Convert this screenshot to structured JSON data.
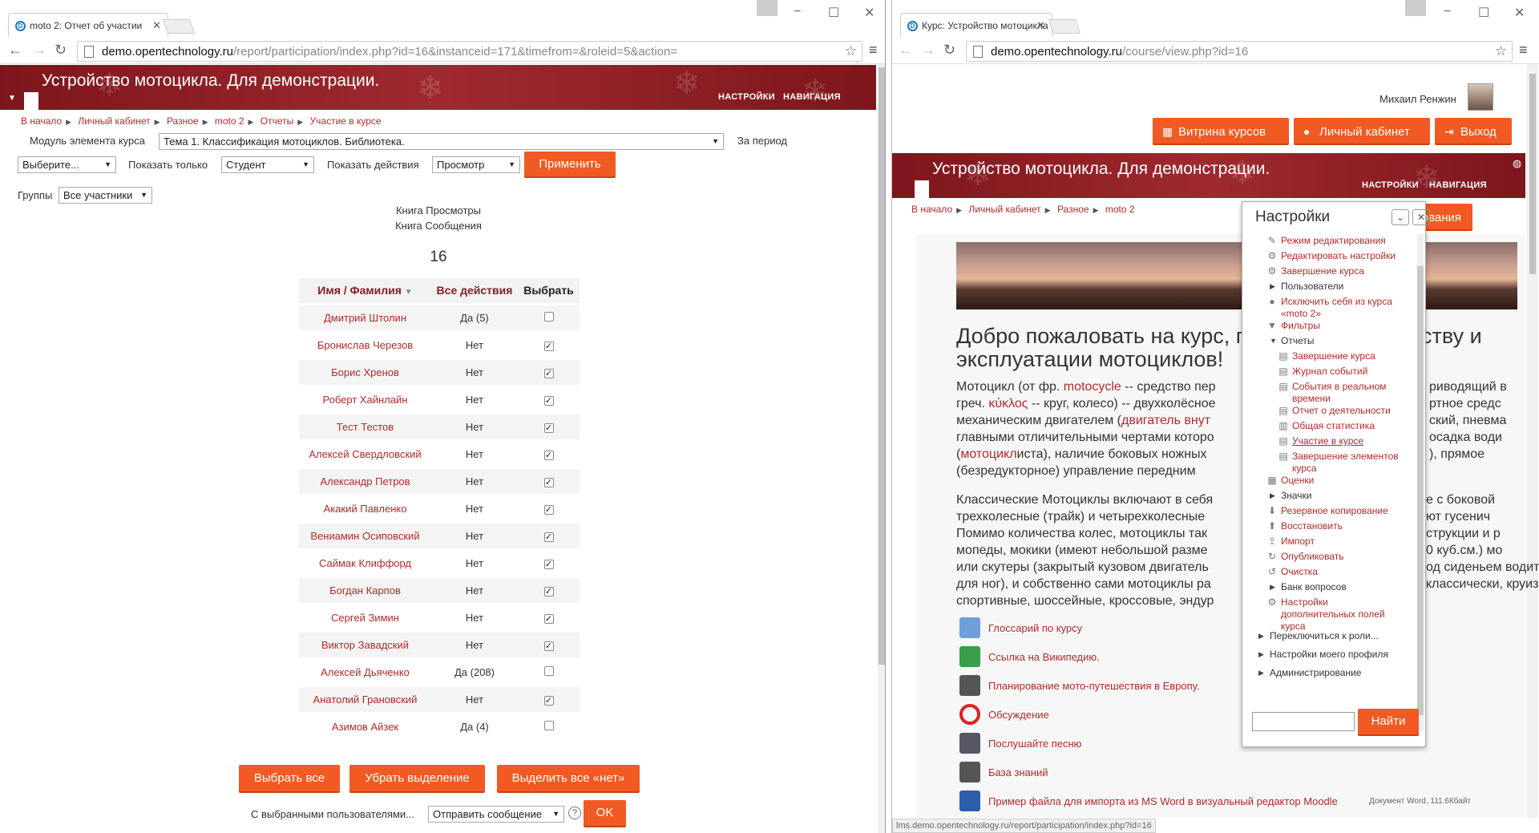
{
  "left": {
    "tab_title": "moto 2: Отчет об участии",
    "url_domain": "demo.opentechnology.ru",
    "url_path": "/report/participation/index.php?id=16&instanceid=171&timefrom=&roleid=5&action=",
    "course_title": "Устройство мотоцикла. Для демонстрации.",
    "nav_settings": "НАСТРОЙКИ",
    "nav_navigation": "НАВИГАЦИЯ",
    "breadcrumb": [
      "В начало",
      "Личный кабинет",
      "Разное",
      "moto 2",
      "Отчеты",
      "Участие в курсе"
    ],
    "form": {
      "module_label": "Модуль элемента курса",
      "module_value": "Тема 1. Классификация мотоциклов. Библиотека.",
      "period_label": "За период",
      "period_value": "Выберите...",
      "show_only_label": "Показать только",
      "show_only_value": "Студент",
      "show_actions_label": "Показать действия",
      "show_actions_value": "Просмотр",
      "apply": "Применить",
      "groups_label": "Группы",
      "groups_value": "Все участники"
    },
    "report": {
      "line1": "Книга Просмотры",
      "line2": "Книга Сообщения",
      "count": "16"
    },
    "table": {
      "headers": {
        "name": "Имя / Фамилия",
        "actions": "Все действия",
        "select": "Выбрать"
      },
      "rows": [
        {
          "name": "Дмитрий Штолин",
          "actions": "Да (5)",
          "checked": false
        },
        {
          "name": "Бронислав Черезов",
          "actions": "Нет",
          "checked": true
        },
        {
          "name": "Борис Хренов",
          "actions": "Нет",
          "checked": true
        },
        {
          "name": "Роберт Хайнлайн",
          "actions": "Нет",
          "checked": true
        },
        {
          "name": "Тест Тестов",
          "actions": "Нет",
          "checked": true
        },
        {
          "name": "Алексей Свердловский",
          "actions": "Нет",
          "checked": true
        },
        {
          "name": "Александр Петров",
          "actions": "Нет",
          "checked": true
        },
        {
          "name": "Акакий Павленко",
          "actions": "Нет",
          "checked": true
        },
        {
          "name": "Вениамин Осиповский",
          "actions": "Нет",
          "checked": true
        },
        {
          "name": "Саймак Клиффорд",
          "actions": "Нет",
          "checked": true
        },
        {
          "name": "Богдан Карпов",
          "actions": "Нет",
          "checked": true
        },
        {
          "name": "Сергей Зимин",
          "actions": "Нет",
          "checked": true
        },
        {
          "name": "Виктор Завадский",
          "actions": "Нет",
          "checked": true
        },
        {
          "name": "Алексей Дьяченко",
          "actions": "Да (208)",
          "checked": false
        },
        {
          "name": "Анатолий Грановский",
          "actions": "Нет",
          "checked": true
        },
        {
          "name": "Азимов Айзек",
          "actions": "Да (4)",
          "checked": false
        }
      ]
    },
    "buttons": {
      "select_all": "Выбрать все",
      "deselect": "Убрать выделение",
      "select_no": "Выделить все «нет»"
    },
    "bulk": {
      "label": "С выбранными пользователями...",
      "value": "Отправить сообщение",
      "ok": "OK"
    }
  },
  "right": {
    "tab_title": "Курс: Устройство мотоцикла",
    "url_domain": "demo.opentechnology.ru",
    "url_path": "/course/view.php?id=16",
    "user_name": "Михаил Ренжин",
    "btn_courses": "Витрина курсов",
    "btn_cabinet": "Личный кабинет",
    "btn_logout": "Выход",
    "course_title": "Устройство мотоцикла. Для демонстрации.",
    "nav_settings": "НАСТРОЙКИ",
    "nav_navigation": "НАВИГАЦИЯ",
    "breadcrumb": [
      "В начало",
      "Личный кабинет",
      "Разное",
      "moto 2"
    ],
    "edit_partial": "ирования",
    "heading_l1": "Добро пожаловать на курс, по",
    "heading_l1b": "ству и",
    "heading_l2": "эксплуатации мотоциклов!",
    "p1": [
      {
        "a": "Мотоцикл (от фр. ",
        "link": "motocycle",
        "b": " -- средство пер"
      },
      {
        "a": "греч. ",
        "link": "κύκλος",
        "b": " -- круг, колесо) -- двухколёсное"
      },
      {
        "a": "механическим двигателем (",
        "link": "двигатель внут",
        "b": ""
      },
      {
        "a": "главными отличительными чертами которо",
        "link": "",
        "b": ""
      },
      {
        "a": "(",
        "link": "мотоцикл",
        "b": "иста), наличие боковых ножных"
      },
      {
        "a": "(безредукторное) управление передним",
        "link": "",
        "b": ""
      }
    ],
    "p1_right": [
      "риводящий в",
      "ртное средс",
      "ский, пневма",
      "осадка води",
      "), прямое",
      ""
    ],
    "p2": [
      "Классические Мотоциклы включают в себя",
      "трехколесные (трайк) и четырехколесные",
      "Помимо количества колес, мотоциклы так",
      "мопеды, мокики (имеют небольшой разме",
      "или скутеры (закрытый кузовом двигатель",
      "для ног), и собственно сами мотоциклы ра",
      "спортивные, шоссейные, кроссовые, эндур"
    ],
    "p2_right": [
      "е с боковой",
      "ют гусенич",
      "струкции и р",
      "0 куб.см.) мо",
      "од сиденьем водителя",
      "классически, круизеры, т",
      ""
    ],
    "resources": [
      {
        "label": "Глоссарий по курсу",
        "icon": "glossary-icon",
        "note": ""
      },
      {
        "label": "Ссылка на Википедию.",
        "icon": "url-icon",
        "note": ""
      },
      {
        "label": "Планирование мото-путешествия в Европу.",
        "icon": "workshop-icon",
        "note": ""
      },
      {
        "label": "Обсуждение",
        "icon": "forum-icon",
        "note": ""
      },
      {
        "label": "Послушайте песню",
        "icon": "audio-icon",
        "note": ""
      },
      {
        "label": "База знаний",
        "icon": "database-icon",
        "note": ""
      },
      {
        "label": "Пример файла для импорта из MS Word в визуальный редактор Moodle",
        "icon": "word-icon",
        "note": "Документ Word, 111.6Кбайт"
      }
    ],
    "settings_dock": {
      "title": "Настройки",
      "items": [
        {
          "label": "Режим редактирования",
          "kind": "link",
          "icon": "pencil-icon",
          "indent": 1
        },
        {
          "label": "Редактировать настройки",
          "kind": "link",
          "icon": "gear-icon",
          "indent": 1
        },
        {
          "label": "Завершение курса",
          "kind": "link",
          "icon": "gear-icon",
          "indent": 1
        },
        {
          "label": "Пользователи",
          "kind": "folder",
          "icon": "tri-right-icon",
          "indent": 1
        },
        {
          "label": "Исключить себя из курса «moto 2»",
          "kind": "link",
          "icon": "user-icon",
          "indent": 1
        },
        {
          "label": "Фильтры",
          "kind": "link",
          "icon": "filter-icon",
          "indent": 1
        },
        {
          "label": "Отчеты",
          "kind": "folder",
          "icon": "tri-down-icon",
          "indent": 1
        },
        {
          "label": "Завершение курса",
          "kind": "link",
          "icon": "report-icon",
          "indent": 2
        },
        {
          "label": "Журнал событий",
          "kind": "link",
          "icon": "report-icon",
          "indent": 2
        },
        {
          "label": "События в реальном времени",
          "kind": "link",
          "icon": "report-icon",
          "indent": 2
        },
        {
          "label": "Отчет о деятельности",
          "kind": "link",
          "icon": "report-icon",
          "indent": 2
        },
        {
          "label": "Общая статистика",
          "kind": "link",
          "icon": "stats-icon",
          "indent": 2
        },
        {
          "label": "Участие в курсе",
          "kind": "active",
          "icon": "report-icon",
          "indent": 2
        },
        {
          "label": "Завершение элементов курса",
          "kind": "link",
          "icon": "report-icon",
          "indent": 2
        },
        {
          "label": "Оценки",
          "kind": "link",
          "icon": "grades-icon",
          "indent": 1
        },
        {
          "label": "Значки",
          "kind": "folder",
          "icon": "tri-right-icon",
          "indent": 1
        },
        {
          "label": "Резервное копирование",
          "kind": "link",
          "icon": "backup-icon",
          "indent": 1
        },
        {
          "label": "Восстановить",
          "kind": "link",
          "icon": "restore-icon",
          "indent": 1
        },
        {
          "label": "Импорт",
          "kind": "link",
          "icon": "import-icon",
          "indent": 1
        },
        {
          "label": "Опубликовать",
          "kind": "link",
          "icon": "publish-icon",
          "indent": 1
        },
        {
          "label": "Очистка",
          "kind": "link",
          "icon": "reset-icon",
          "indent": 1
        },
        {
          "label": "Банк вопросов",
          "kind": "folder",
          "icon": "tri-right-icon",
          "indent": 1
        },
        {
          "label": "Настройки дополнительных полей курса",
          "kind": "link",
          "icon": "gear-icon",
          "indent": 1
        },
        {
          "label": "Переключиться к роли...",
          "kind": "folder",
          "icon": "tri-right-icon",
          "indent": 0
        },
        {
          "label": "Настройки моего профиля",
          "kind": "folder",
          "icon": "tri-right-icon",
          "indent": 0
        },
        {
          "label": "Администрирование",
          "kind": "folder",
          "icon": "tri-right-icon",
          "indent": 0
        }
      ],
      "search_button": "Найти"
    },
    "status_url": "lms.demo.opentechnology.ru/report/participation/index.php?id=16"
  },
  "colors": {
    "banner": "#8b1c22",
    "accent": "#f15a22",
    "link": "#b32a2a"
  }
}
